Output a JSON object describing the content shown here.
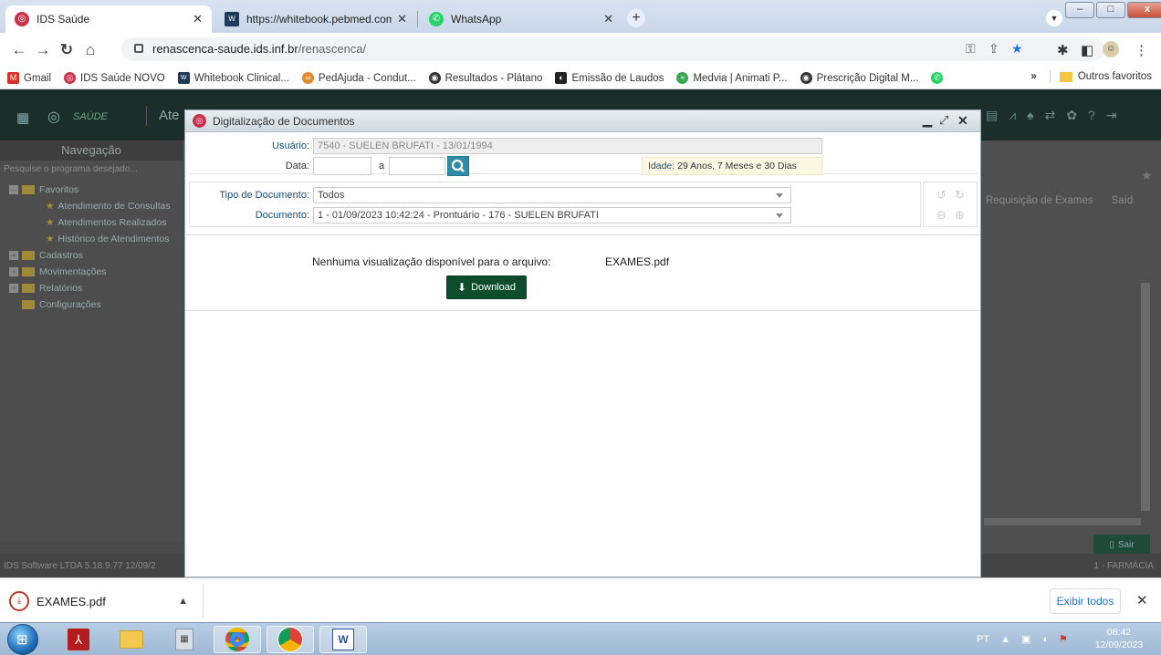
{
  "browser": {
    "tabs": [
      {
        "title": "IDS Saúde",
        "active": true
      },
      {
        "title": "https://whitebook.pebmed.com.b",
        "active": false
      },
      {
        "title": "WhatsApp",
        "active": false
      }
    ],
    "url_host": "renascenca-saude.ids.inf.br",
    "url_path": "/renascenca/",
    "new_tab_glyph": "+",
    "window_buttons": {
      "minimize": "–",
      "maximize": "□",
      "close": "x"
    },
    "bookmarks": [
      {
        "label": "Gmail",
        "icon": "gmail-icon",
        "color": "#d93025"
      },
      {
        "label": "IDS Saúde NOVO",
        "icon": "ids-icon",
        "color": "#c9324a"
      },
      {
        "label": "Whitebook Clinical...",
        "icon": "whitebook-icon",
        "color": "#1f3a5a"
      },
      {
        "label": "PedAjuda - Condut...",
        "icon": "pedajuda-icon",
        "color": "#e08a2a"
      },
      {
        "label": "Resultados - Plátano",
        "icon": "globe-icon",
        "color": "#333333"
      },
      {
        "label": "Emissão de Laudos",
        "icon": "laudos-icon",
        "color": "#222222"
      },
      {
        "label": "Medvia | Animati P...",
        "icon": "medvia-icon",
        "color": "#3aa552"
      },
      {
        "label": "Prescrição Digital M...",
        "icon": "globe-icon",
        "color": "#333333"
      }
    ],
    "bookmarks_overflow": "»",
    "other_bookmarks": "Outros favoritos"
  },
  "app": {
    "topbar_brand": "SAÚDE",
    "topbar_partial": "Ate",
    "nav_title": "Navegação",
    "nav_search_placeholder": "Pesquise o programa desejado...",
    "tree": [
      {
        "label": "Favoritos",
        "kind": "folder",
        "expander": "–"
      },
      {
        "label": "Atendimento de Consultas",
        "kind": "star"
      },
      {
        "label": "Atendimentos Realizados",
        "kind": "star"
      },
      {
        "label": "Histórico de Atendimentos",
        "kind": "star"
      },
      {
        "label": "Cadastros",
        "kind": "folder",
        "expander": "+"
      },
      {
        "label": "Movimentações",
        "kind": "folder",
        "expander": "+"
      },
      {
        "label": "Relatórios",
        "kind": "folder",
        "expander": "+"
      },
      {
        "label": "Configurações",
        "kind": "folder"
      }
    ],
    "right_tabs": [
      "Requisição de Exames",
      "Saíd"
    ],
    "exit_label": "Sair",
    "status_left": "IDS Software LTDA   5.18.9.77   12/09/2",
    "status_right": "1 - FARMÁCIA"
  },
  "modal": {
    "title": "Digitalização de Documentos",
    "usuario_label": "Usuário:",
    "usuario_value": "7540 - SUELEN BRUFATI - 13/01/1994",
    "data_label": "Data:",
    "data_from": "",
    "data_sep": "a",
    "data_to": "",
    "idade_label": "Idade:",
    "idade_value": "29 Anos, 7 Meses e 30 Dias",
    "tipo_label": "Tipo de Documento:",
    "tipo_value": "Todos",
    "documento_label": "Documento:",
    "documento_value": "1 - 01/09/2023 10:42:24 - Prontuário - 176 - SUELEN BRUFATI",
    "no_preview": "Nenhuma visualização disponível para o arquivo:",
    "filename": "EXAMES.pdf",
    "download": "Download",
    "colors": {
      "label_blue": "#1c4f7a",
      "download_bg": "#0e4d2b",
      "search_btn": "#2f8ca5"
    }
  },
  "downloads": {
    "file": "EXAMES.pdf",
    "show_all": "Exibir todos",
    "close": "✕"
  },
  "taskbar": {
    "lang": "PT",
    "time": "08:42",
    "date": "12/09/2023"
  }
}
